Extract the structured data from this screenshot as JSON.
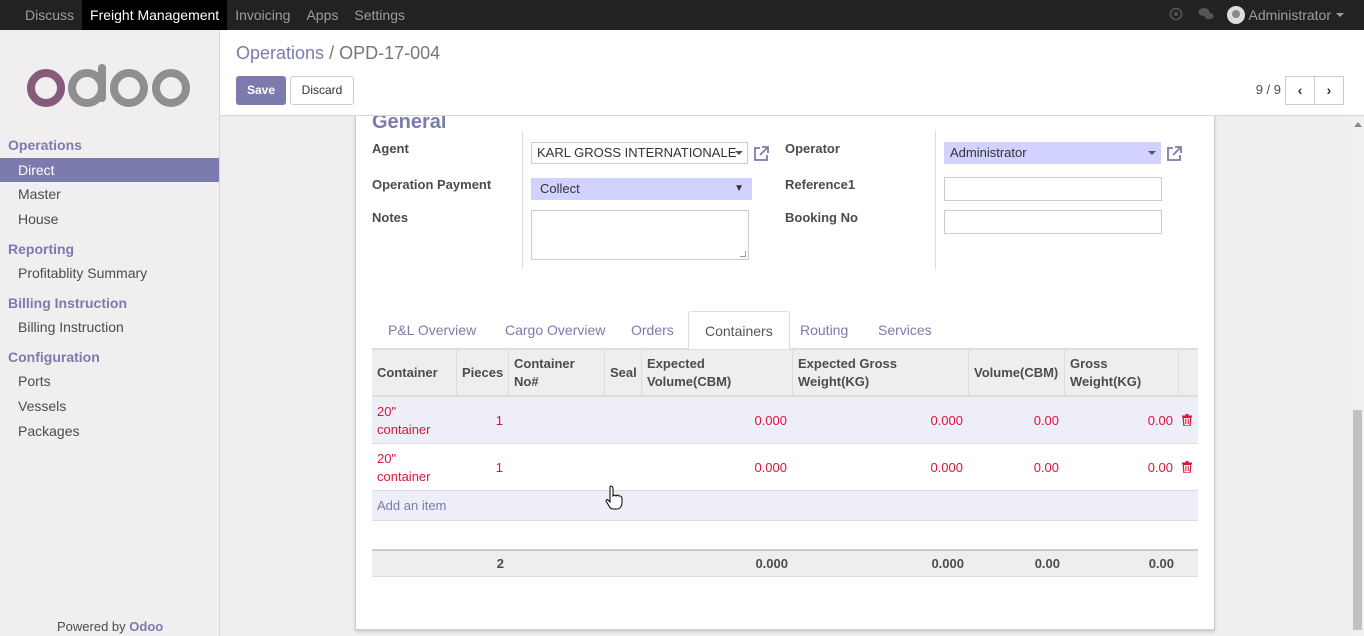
{
  "topbar": {
    "menu": [
      "Discuss",
      "Freight Management",
      "Invoicing",
      "Apps",
      "Settings"
    ],
    "active_menu": "Freight Management",
    "user": "Administrator",
    "icons": [
      "chat-icon",
      "messages-icon"
    ]
  },
  "sidebar": {
    "sections": [
      {
        "title": "Operations",
        "items": [
          "Direct",
          "Master",
          "House"
        ]
      },
      {
        "title": "Reporting",
        "items": [
          "Profitablity Summary"
        ]
      },
      {
        "title": "Billing Instruction",
        "items": [
          "Billing Instruction"
        ]
      },
      {
        "title": "Configuration",
        "items": [
          "Ports",
          "Vessels",
          "Packages"
        ]
      }
    ],
    "active_item": "Direct",
    "powered_by": "Powered by",
    "powered_brand": "Odoo"
  },
  "control_panel": {
    "breadcrumb_parent": "Operations",
    "breadcrumb_sep": "/",
    "breadcrumb_current": "OPD-17-004",
    "save_label": "Save",
    "discard_label": "Discard",
    "pager": "9 / 9"
  },
  "form": {
    "section_title": "General",
    "agent_label": "Agent",
    "agent_value": "KARL GROSS INTERNATIONALE",
    "operation_payment_label": "Operation Payment",
    "operation_payment_value": "Collect",
    "notes_label": "Notes",
    "operator_label": "Operator",
    "operator_value": "Administrator",
    "reference1_label": "Reference1",
    "booking_no_label": "Booking No"
  },
  "tabs": [
    "P&L Overview",
    "Cargo Overview",
    "Orders",
    "Containers",
    "Routing",
    "Services"
  ],
  "active_tab": "Containers",
  "containers_table": {
    "headers": [
      "Container",
      "Pieces",
      "Container No#",
      "Seal",
      "Expected Volume(CBM)",
      "Expected Gross Weight(KG)",
      "Volume(CBM)",
      "Gross Weight(KG)"
    ],
    "rows": [
      {
        "container": "20\" container",
        "pieces": "1",
        "container_no": "",
        "seal": "",
        "expected_volume": "0.000",
        "expected_gross_weight": "0.000",
        "volume": "0.00",
        "gross_weight": "0.00"
      },
      {
        "container": "20\" container",
        "pieces": "1",
        "container_no": "",
        "seal": "",
        "expected_volume": "0.000",
        "expected_gross_weight": "0.000",
        "volume": "0.00",
        "gross_weight": "0.00"
      }
    ],
    "add_item_label": "Add an item",
    "totals": {
      "pieces": "2",
      "expected_volume": "0.000",
      "expected_gross_weight": "0.000",
      "volume": "0.00",
      "gross_weight": "0.00"
    }
  },
  "colors": {
    "accent": "#7c7bad",
    "topbar": "#222222",
    "row_text": "#dc143c",
    "filled_field": "#d2d2ff"
  }
}
